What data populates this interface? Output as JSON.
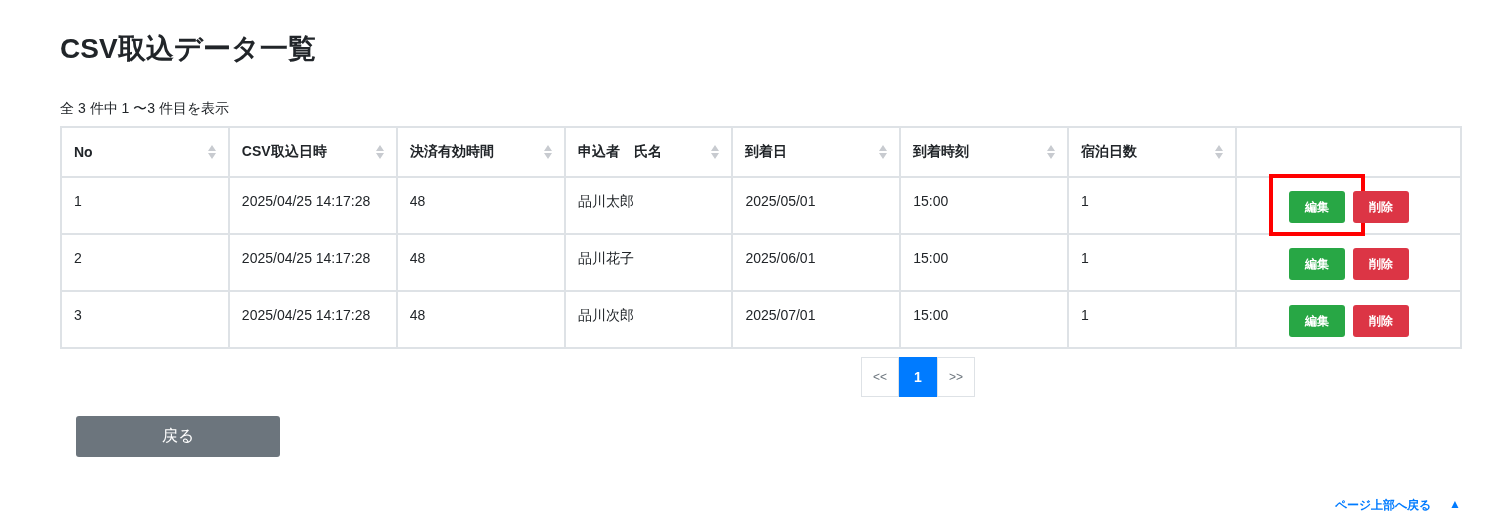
{
  "title": "CSV取込データ一覧",
  "summary": "全 3 件中 1 〜3 件目を表示",
  "table": {
    "columns": [
      {
        "label": "No",
        "sortable": true
      },
      {
        "label": "CSV取込日時",
        "sortable": true
      },
      {
        "label": "決済有効時間",
        "sortable": true
      },
      {
        "label": "申込者　氏名",
        "sortable": true
      },
      {
        "label": "到着日",
        "sortable": true
      },
      {
        "label": "到着時刻",
        "sortable": true
      },
      {
        "label": "宿泊日数",
        "sortable": true
      }
    ],
    "rows": [
      {
        "cells": [
          "1",
          "2025/04/25 14:17:28",
          "48",
          "品川太郎",
          "2025/05/01",
          "15:00",
          "1"
        ],
        "edit": "編集",
        "delete": "削除",
        "highlighted": true
      },
      {
        "cells": [
          "2",
          "2025/04/25 14:17:28",
          "48",
          "品川花子",
          "2025/06/01",
          "15:00",
          "1"
        ],
        "edit": "編集",
        "delete": "削除",
        "highlighted": false
      },
      {
        "cells": [
          "3",
          "2025/04/25 14:17:28",
          "48",
          "品川次郎",
          "2025/07/01",
          "15:00",
          "1"
        ],
        "edit": "編集",
        "delete": "削除",
        "highlighted": false
      }
    ]
  },
  "pagination": {
    "prev": "<<",
    "pages": [
      {
        "label": "1",
        "selected": true
      }
    ],
    "next": ">>"
  },
  "back_button": "戻る",
  "page_top_link": {
    "label": "ページ上部へ戻る",
    "arrow": "▲"
  }
}
